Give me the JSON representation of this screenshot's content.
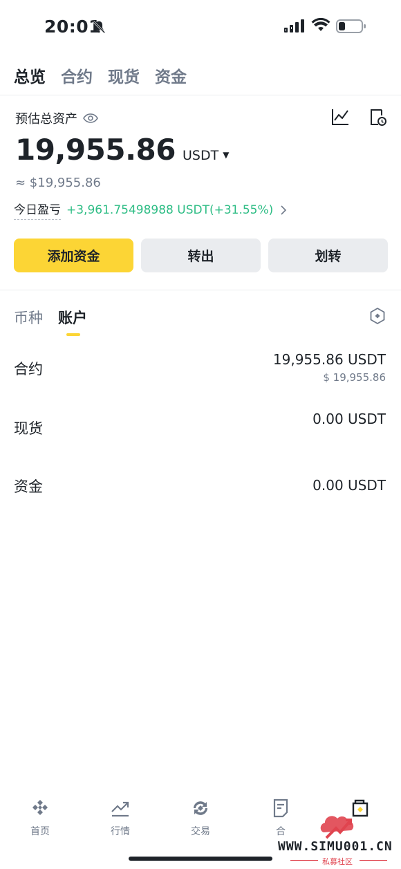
{
  "status_bar": {
    "time": "20:01",
    "icons": [
      "bell-muted-icon",
      "cellular-signal-icon",
      "wifi-icon",
      "battery-icon"
    ]
  },
  "top_tabs": [
    {
      "label": "总览",
      "active": true
    },
    {
      "label": "合约",
      "active": false
    },
    {
      "label": "现货",
      "active": false
    },
    {
      "label": "资金",
      "active": false
    }
  ],
  "overview": {
    "estimated_label": "预估总资产",
    "balance": "19,955.86",
    "unit": "USDT",
    "approx_usd": "≈ $19,955.86",
    "pnl_label": "今日盈亏",
    "pnl_value": "+3,961.75498988 USDT(+31.55%)",
    "icons": [
      "eye-icon",
      "line-chart-icon",
      "history-icon"
    ]
  },
  "actions": {
    "add_funds": "添加资金",
    "withdraw": "转出",
    "transfer": "划转"
  },
  "sub_tabs": [
    {
      "label": "币种",
      "active": false
    },
    {
      "label": "账户",
      "active": true
    }
  ],
  "accounts": [
    {
      "name": "合约",
      "amount": "19,955.86 USDT",
      "usd": "$ 19,955.86"
    },
    {
      "name": "现货",
      "amount": "0.00 USDT",
      "usd": ""
    },
    {
      "name": "资金",
      "amount": "0.00 USDT",
      "usd": ""
    }
  ],
  "bottom_nav": [
    {
      "label": "首页",
      "icon": "binance-logo-icon"
    },
    {
      "label": "行情",
      "icon": "market-trend-icon"
    },
    {
      "label": "交易",
      "icon": "trade-exchange-icon"
    },
    {
      "label": "合",
      "icon": "futures-doc-icon"
    },
    {
      "label": "",
      "icon": "wallet-icon"
    }
  ],
  "watermark": {
    "site": "WWW.SIMU001.CN",
    "sub": "私募社区"
  },
  "colors": {
    "accent_yellow": "#fcd535",
    "positive_green": "#2ebd85",
    "text_primary": "#1e2329",
    "text_secondary": "#707a8a",
    "button_gray": "#eaecef"
  }
}
